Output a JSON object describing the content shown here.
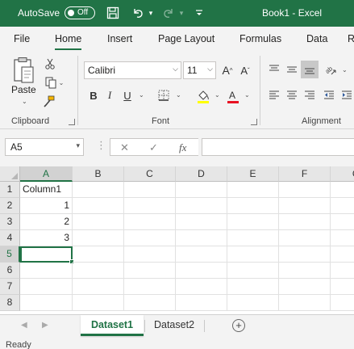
{
  "titlebar": {
    "autosave_label": "AutoSave",
    "autosave_state": "Off",
    "document_title": "Book1  -  Excel",
    "color": "#217346"
  },
  "menu": {
    "tabs": [
      "File",
      "Home",
      "Insert",
      "Page Layout",
      "Formulas",
      "Data"
    ],
    "active_tab": "Home"
  },
  "ribbon": {
    "clipboard": {
      "label": "Clipboard",
      "paste_label": "Paste"
    },
    "font": {
      "label": "Font",
      "font_name": "Calibri",
      "font_size": "11",
      "bold": "B",
      "italic": "I",
      "underline": "U",
      "font_color": "#e81123",
      "highlight_color": "#ffff00"
    },
    "alignment": {
      "label": "Alignment"
    }
  },
  "formula_bar": {
    "name_box": "A5",
    "fx_label": "fx",
    "formula": ""
  },
  "grid": {
    "columns": [
      "A",
      "B",
      "C",
      "D",
      "E",
      "F",
      "G"
    ],
    "rows": [
      "1",
      "2",
      "3",
      "4",
      "5",
      "6",
      "7",
      "8"
    ],
    "selected_column": "A",
    "selected_row": "5",
    "active_cell": "A5",
    "cells": {
      "A1": "Column1",
      "A2": "1",
      "A3": "2",
      "A4": "3"
    }
  },
  "sheets": {
    "tabs": [
      "Dataset1",
      "Dataset2"
    ],
    "active": "Dataset1"
  },
  "status": {
    "text": "Ready"
  }
}
